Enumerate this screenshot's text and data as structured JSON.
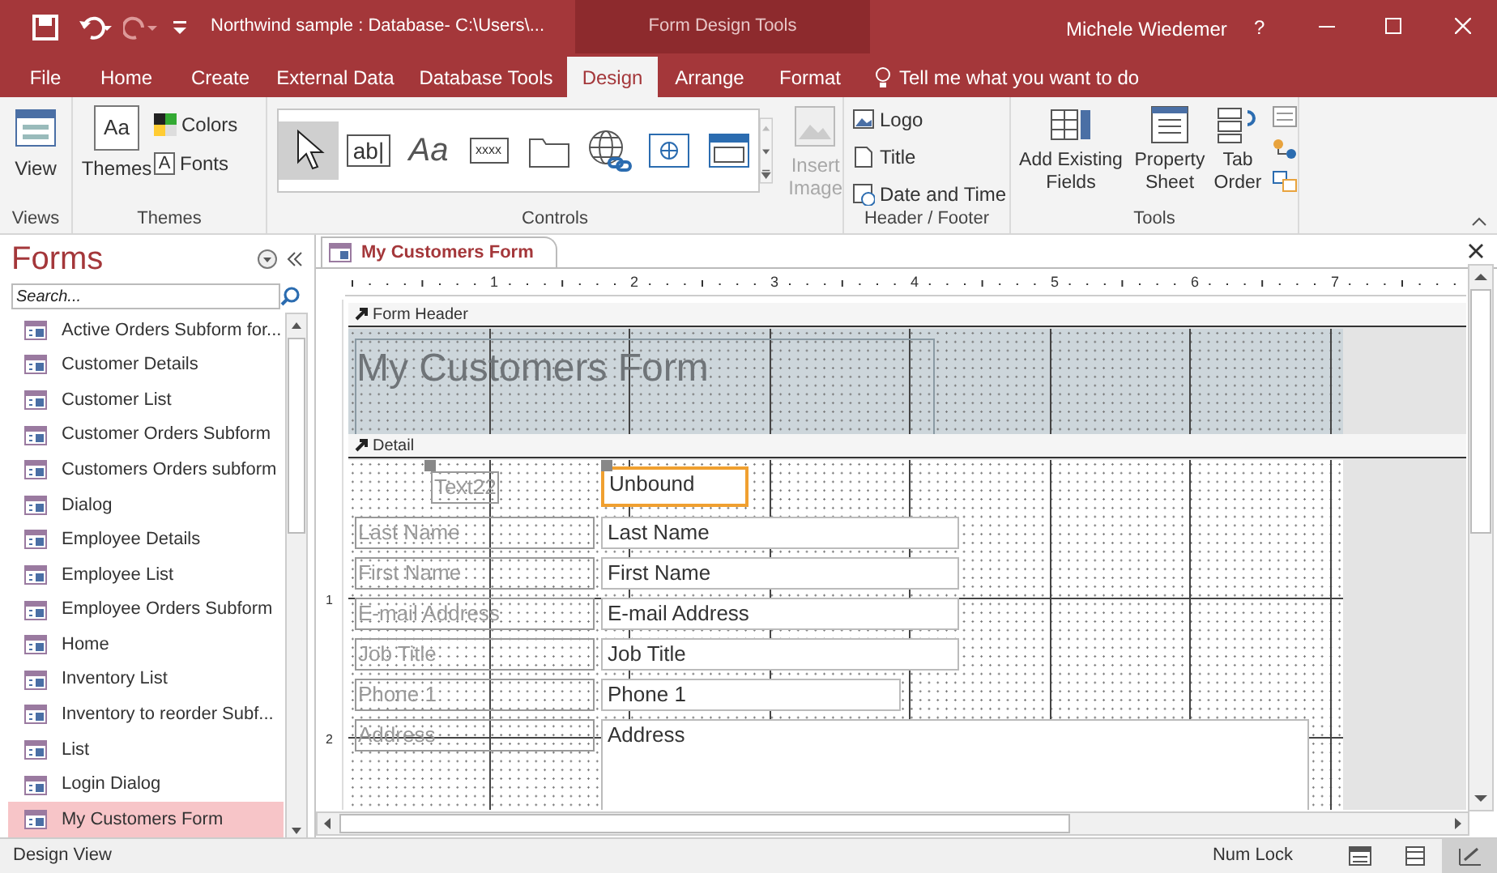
{
  "title_bar": {
    "title": "Northwind sample : Database- C:\\Users\\...",
    "contextual": "Form Design Tools",
    "user": "Michele Wiedemer",
    "help": "?"
  },
  "ribbon_tabs": [
    {
      "label": "File",
      "selected": false
    },
    {
      "label": "Home",
      "selected": false
    },
    {
      "label": "Create",
      "selected": false
    },
    {
      "label": "External Data",
      "selected": false
    },
    {
      "label": "Database Tools",
      "selected": false
    },
    {
      "label": "Design",
      "selected": true
    },
    {
      "label": "Arrange",
      "selected": false
    },
    {
      "label": "Format",
      "selected": false
    }
  ],
  "tell_me": "Tell me what you want to do",
  "ribbon": {
    "views": {
      "button": "View",
      "label": "Views"
    },
    "themes": {
      "themes": "Themes",
      "themes_glyph": "Aa",
      "colors": "Colors",
      "fonts": "Fonts",
      "fonts_glyph": "A",
      "label": "Themes"
    },
    "controls": {
      "label": "Controls",
      "items": [
        {
          "kind": "pointer",
          "selected": true
        },
        {
          "kind": "textbox",
          "glyph": "ab|",
          "selected": false
        },
        {
          "kind": "label",
          "glyph": "Aa",
          "selected": false
        },
        {
          "kind": "button",
          "glyph": "xxxx",
          "selected": false
        },
        {
          "kind": "tab",
          "selected": false
        },
        {
          "kind": "hyperlink",
          "selected": false
        },
        {
          "kind": "browser",
          "selected": false
        },
        {
          "kind": "navigation",
          "selected": false
        }
      ]
    },
    "insert_image": {
      "label": "Insert Image",
      "disabled": true
    },
    "header_footer": {
      "label": "Header / Footer",
      "items": [
        {
          "kind": "logo",
          "label": "Logo"
        },
        {
          "kind": "title",
          "label": "Title"
        },
        {
          "kind": "date",
          "label": "Date and Time"
        }
      ]
    },
    "tools": {
      "label": "Tools",
      "items": [
        "Add Existing Fields",
        "Property Sheet",
        "Tab Order"
      ]
    }
  },
  "nav": {
    "title": "Forms",
    "search_placeholder": "Search...",
    "items": [
      {
        "label": "Active Orders Subform for...",
        "selected": false
      },
      {
        "label": "Customer Details",
        "selected": false
      },
      {
        "label": "Customer List",
        "selected": false
      },
      {
        "label": "Customer Orders Subform",
        "selected": false
      },
      {
        "label": "Customers Orders subform",
        "selected": false
      },
      {
        "label": "Dialog",
        "selected": false
      },
      {
        "label": "Employee Details",
        "selected": false
      },
      {
        "label": "Employee List",
        "selected": false
      },
      {
        "label": "Employee Orders Subform",
        "selected": false
      },
      {
        "label": "Home",
        "selected": false
      },
      {
        "label": "Inventory List",
        "selected": false
      },
      {
        "label": "Inventory to reorder Subf...",
        "selected": false
      },
      {
        "label": "List",
        "selected": false
      },
      {
        "label": "Login Dialog",
        "selected": false
      },
      {
        "label": "My Customers Form",
        "selected": true
      }
    ]
  },
  "document": {
    "tab": "My Customers Form",
    "ruler": [
      "1",
      "2",
      "3",
      "4",
      "5",
      "6",
      "7"
    ],
    "vruler": [
      "1",
      "2"
    ],
    "form_header": {
      "bar": "Form Header",
      "title": "My Customers Form"
    },
    "detail": {
      "bar": "Detail",
      "rows": [
        {
          "label": "Text22",
          "field": "Unbound",
          "selected": true
        },
        {
          "label": "Last Name",
          "field": "Last Name",
          "selected": false
        },
        {
          "label": "First Name",
          "field": "First Name",
          "selected": false
        },
        {
          "label": "E-mail Address",
          "field": "E-mail Address",
          "selected": false
        },
        {
          "label": "Job Title",
          "field": "Job Title",
          "selected": false
        },
        {
          "label": "Phone 1",
          "field": "Phone 1",
          "selected": false
        },
        {
          "label": "Address",
          "field": "Address",
          "selected": false
        }
      ]
    }
  },
  "status_bar": {
    "text": "Design View",
    "num_lock": "Num Lock",
    "views": [
      {
        "kind": "form",
        "selected": false
      },
      {
        "kind": "layout",
        "selected": false
      },
      {
        "kind": "design",
        "selected": true
      }
    ]
  }
}
